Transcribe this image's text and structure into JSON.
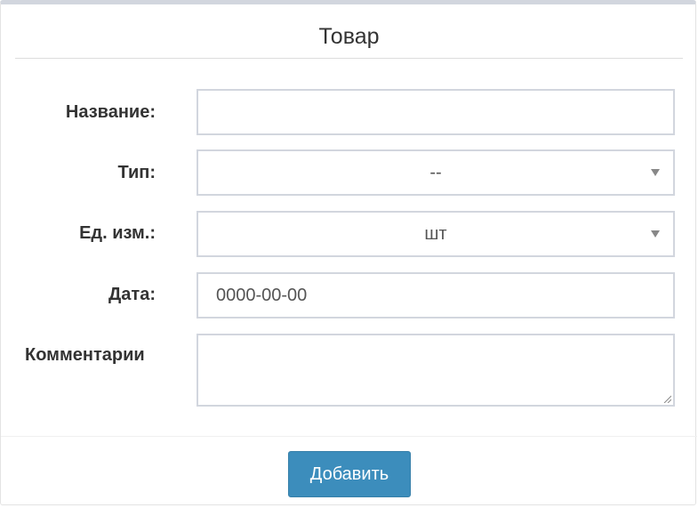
{
  "form": {
    "title": "Товар",
    "fields": {
      "name": {
        "label": "Название:",
        "value": ""
      },
      "type": {
        "label": "Тип:",
        "selected": "--"
      },
      "unit": {
        "label": "Ед. изм.:",
        "selected": "шт"
      },
      "date": {
        "label": "Дата:",
        "value": "0000-00-00"
      },
      "comments": {
        "label": "Комментарии",
        "value": ""
      }
    },
    "submit_label": "Добавить"
  },
  "colors": {
    "button": "#3c8dbc",
    "panel_top_border": "#d2d6de",
    "input_border": "#d2d6de"
  }
}
